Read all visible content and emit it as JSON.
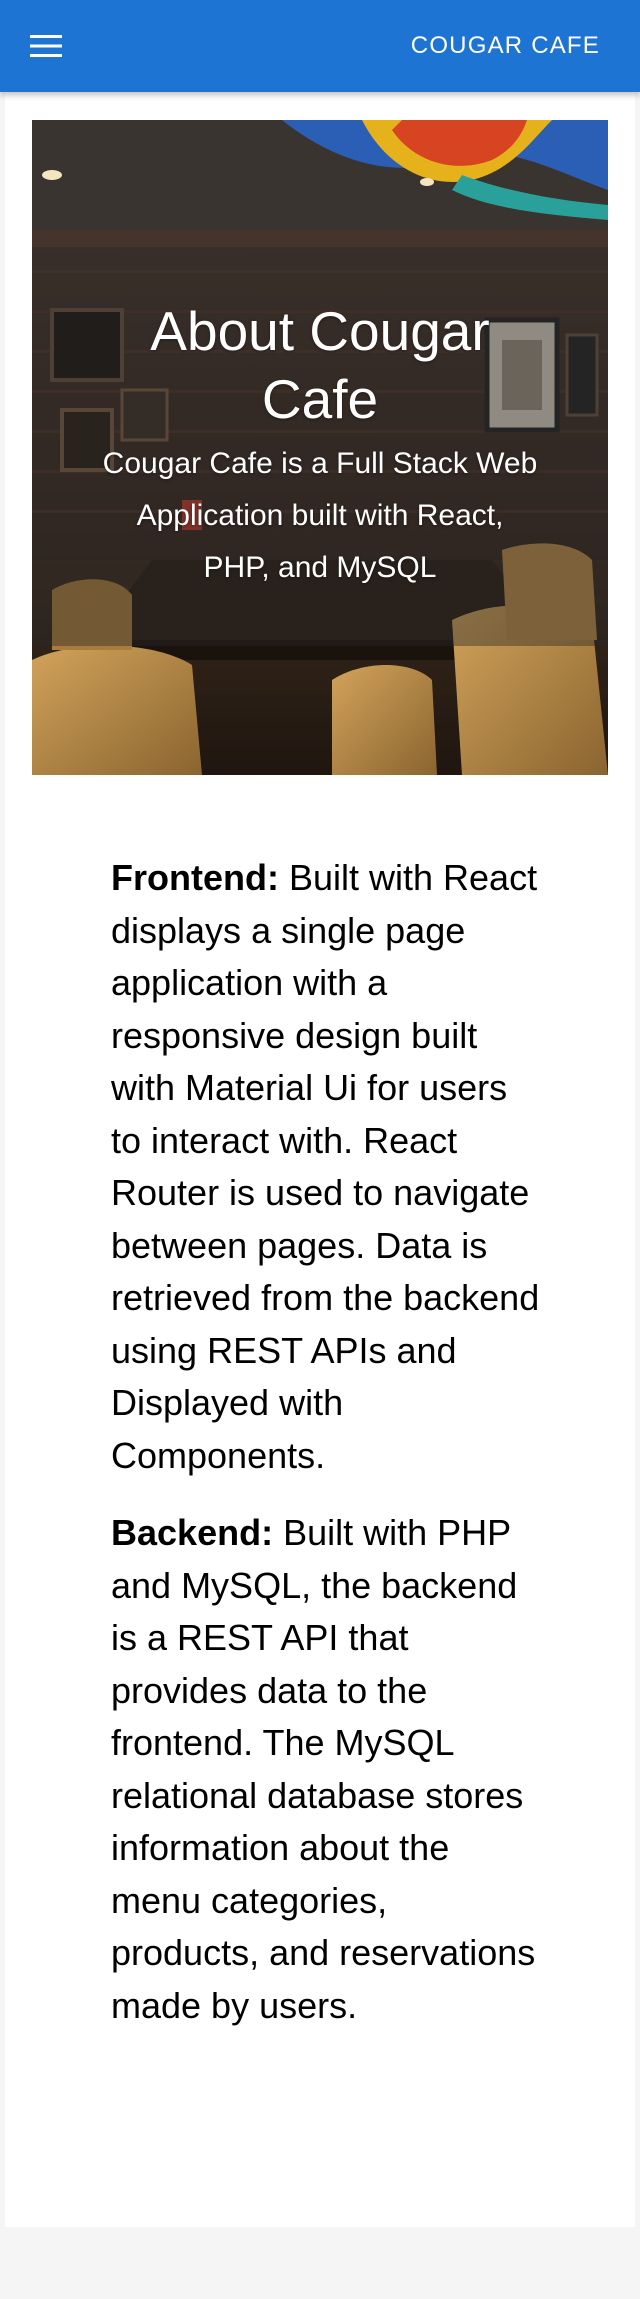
{
  "appbar": {
    "brand": "COUGAR CAFE",
    "menu_icon": "hamburger-menu-icon",
    "color": "#1e74d2"
  },
  "hero": {
    "title": "About Cougar Cafe",
    "subtitle": "Cougar Cafe is a Full Stack Web Application built with React, PHP, and MySQL"
  },
  "content": {
    "frontend": {
      "label": "Frontend:",
      "text": " Built with React displays a single page application with a responsive design built with Material Ui for users to interact with. React Router is used to navigate between pages. Data is retrieved from the backend using REST APIs and Displayed with Components."
    },
    "backend": {
      "label": "Backend:",
      "text": " Built with PHP and MySQL, the backend is a REST API that provides data to the frontend. The MySQL relational database stores information about the menu categories, products, and reservations made by users."
    }
  }
}
